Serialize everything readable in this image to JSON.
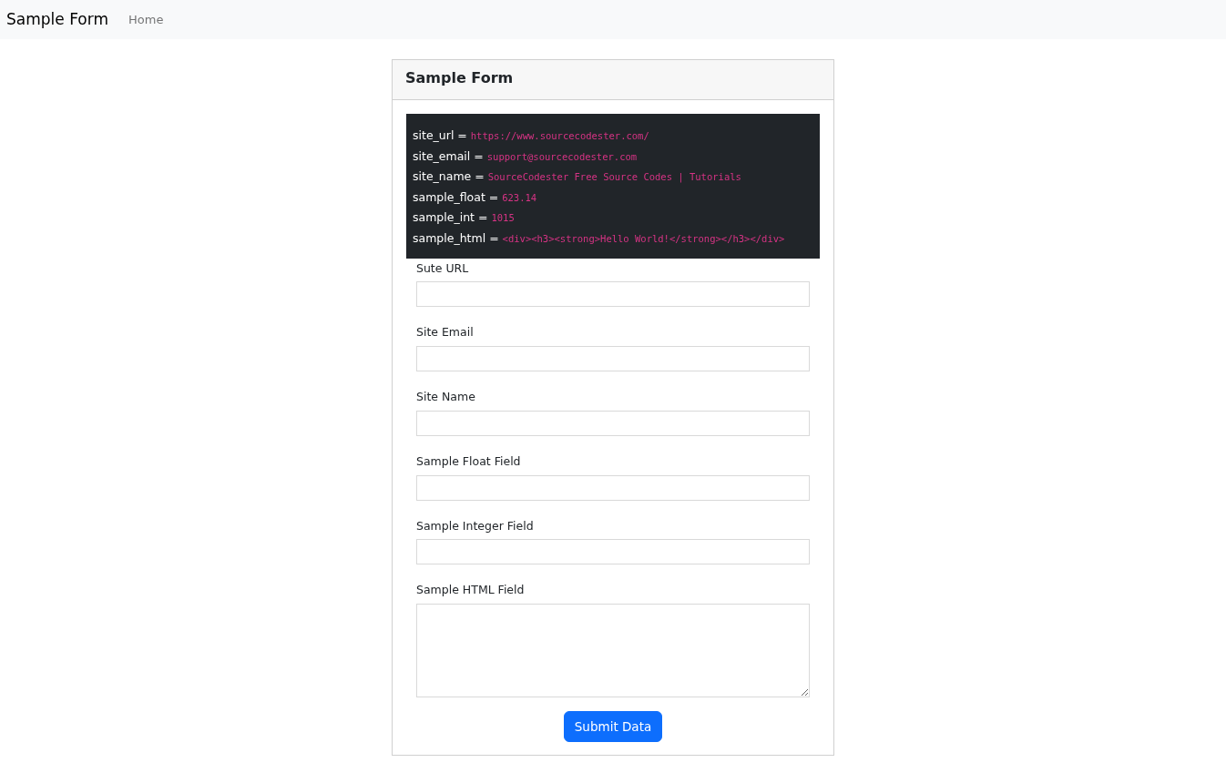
{
  "navbar": {
    "brand": "Sample Form",
    "links": [
      {
        "label": "Home",
        "selected": false
      }
    ]
  },
  "card": {
    "title": "Sample Form",
    "code_lines": [
      {
        "name": "site_url =",
        "value": "https://www.sourcecodester.com/"
      },
      {
        "name": "site_email =",
        "value": "support@sourcecodester.com"
      },
      {
        "name": "site_name =",
        "value": "SourceCodester Free Source Codes | Tutorials"
      },
      {
        "name": "sample_float =",
        "value": "623.14"
      },
      {
        "name": "sample_int =",
        "value": "1015"
      },
      {
        "name": "sample_html =",
        "value": "<div><h3><strong>Hello World!</strong></h3></div>"
      }
    ],
    "fields": [
      {
        "label": "Sute URL",
        "kind": "input"
      },
      {
        "label": "Site Email",
        "kind": "input"
      },
      {
        "label": "Site Name",
        "kind": "input"
      },
      {
        "label": "Sample Float Field",
        "kind": "input"
      },
      {
        "label": "Sample Integer Field",
        "kind": "input"
      },
      {
        "label": "Sample HTML Field",
        "kind": "textarea"
      }
    ],
    "submit_button": "Submit Data"
  }
}
